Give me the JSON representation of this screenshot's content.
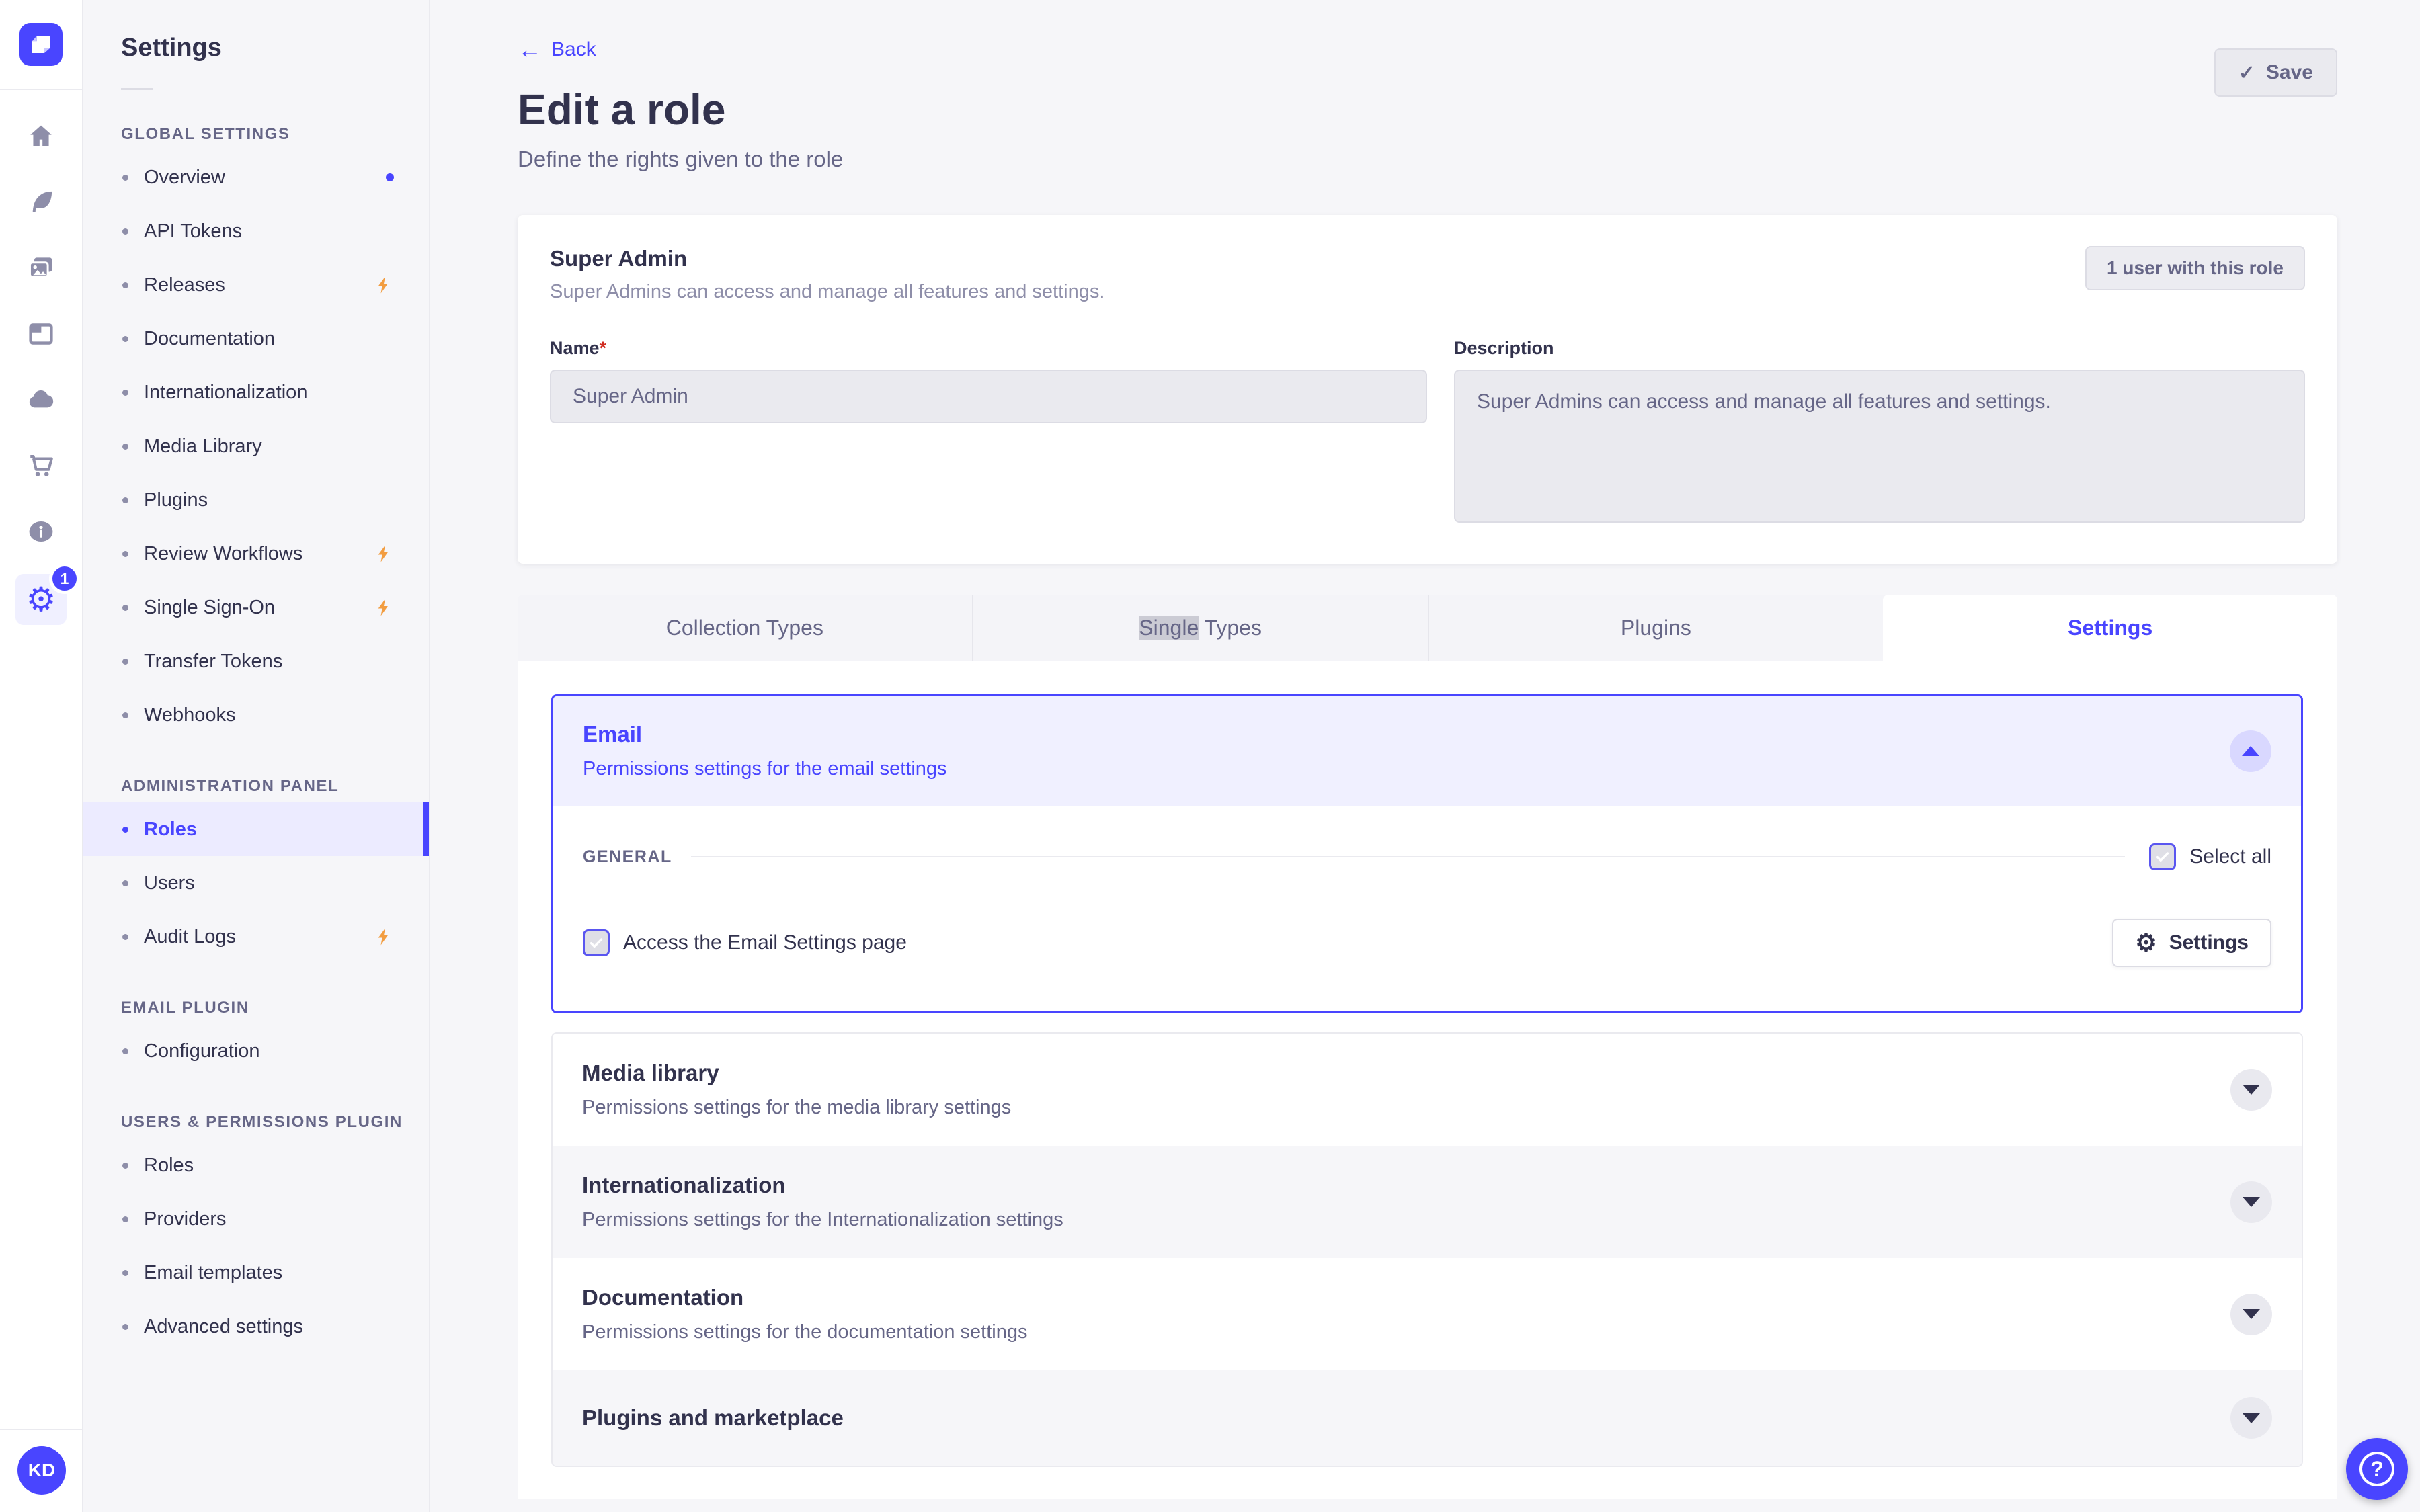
{
  "colors": {
    "accent": "#4945ff",
    "accent_light_bg": "#f0f0ff",
    "warning_bolt": "#f29d41",
    "text_dark": "#32324d",
    "text_gray": "#666687",
    "disabled_bg": "#eaeaef"
  },
  "rail": {
    "logo_icon": "strapi-logo",
    "settings_badge": "1",
    "avatar_initials": "KD"
  },
  "sidebar": {
    "title": "Settings",
    "sections": [
      {
        "header": "GLOBAL SETTINGS",
        "items": [
          {
            "label": "Overview"
          },
          {
            "label": "API Tokens"
          },
          {
            "label": "Releases"
          },
          {
            "label": "Documentation"
          },
          {
            "label": "Internationalization"
          },
          {
            "label": "Media Library"
          },
          {
            "label": "Plugins"
          },
          {
            "label": "Review Workflows"
          },
          {
            "label": "Single Sign-On"
          },
          {
            "label": "Transfer Tokens"
          },
          {
            "label": "Webhooks"
          }
        ]
      },
      {
        "header": "ADMINISTRATION PANEL",
        "items": [
          {
            "label": "Roles"
          },
          {
            "label": "Users"
          },
          {
            "label": "Audit Logs"
          }
        ]
      },
      {
        "header": "EMAIL PLUGIN",
        "items": [
          {
            "label": "Configuration"
          }
        ]
      },
      {
        "header": "USERS & PERMISSIONS PLUGIN",
        "items": [
          {
            "label": "Roles"
          },
          {
            "label": "Providers"
          },
          {
            "label": "Email templates"
          },
          {
            "label": "Advanced settings"
          }
        ]
      }
    ]
  },
  "page": {
    "back_label": "Back",
    "title": "Edit a role",
    "subtitle": "Define the rights given to the role",
    "save_label": "Save",
    "save_check": "✓"
  },
  "role_card": {
    "title": "Super Admin",
    "subtitle": "Super Admins can access and manage all features and settings.",
    "users_button": "1 user with this role",
    "name_label": "Name",
    "required_mark": "*",
    "name_value": "Super Admin",
    "description_label": "Description",
    "description_value": "Super Admins can access and manage all features and settings."
  },
  "tabs": {
    "collection_types": "Collection Types",
    "single_types_selected_word": "Single",
    "single_types_rest": " Types",
    "plugins": "Plugins",
    "settings": "Settings"
  },
  "email_panel": {
    "title": "Email",
    "subtitle": "Permissions settings for the email settings",
    "section_label": "GENERAL",
    "select_all_label": "Select all",
    "permission_label": "Access the Email Settings page",
    "settings_button": "Settings",
    "gear_glyph": "⚙"
  },
  "accordions": [
    {
      "title": "Media library",
      "subtitle": "Permissions settings for the media library settings"
    },
    {
      "title": "Internationalization",
      "subtitle": "Permissions settings for the Internationalization settings"
    },
    {
      "title": "Documentation",
      "subtitle": "Permissions settings for the documentation settings"
    },
    {
      "title": "Plugins and marketplace",
      "subtitle": ""
    }
  ],
  "help_button": "?"
}
